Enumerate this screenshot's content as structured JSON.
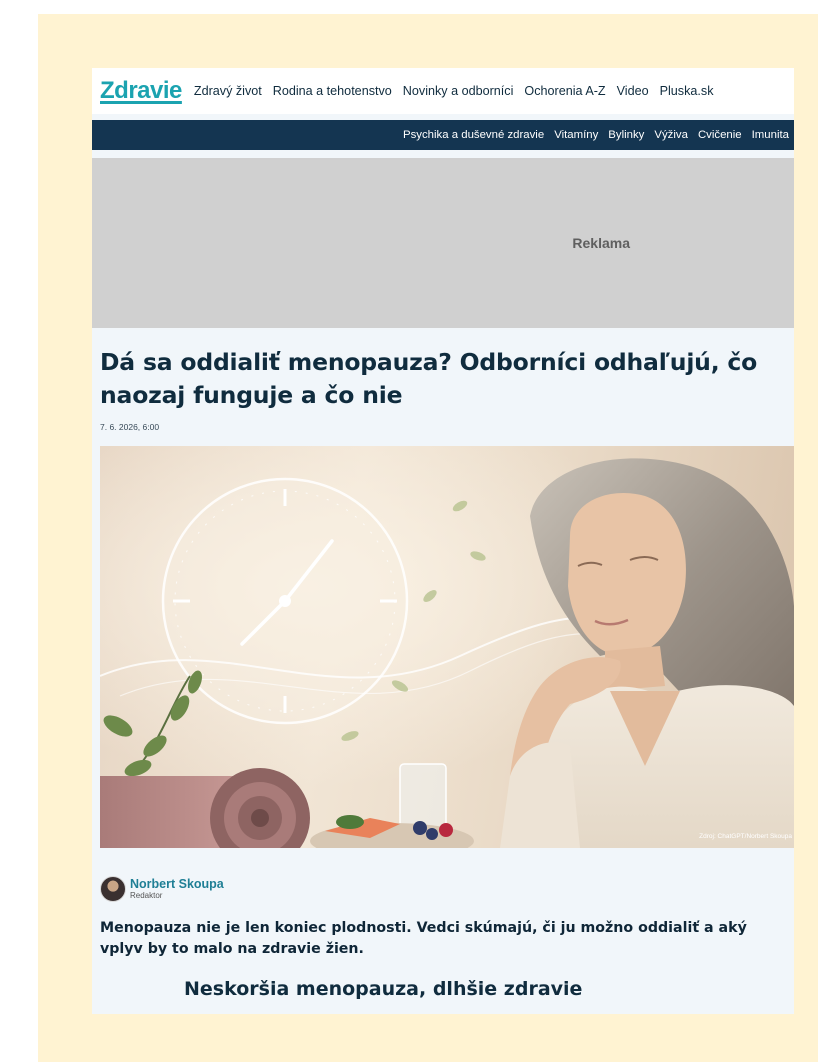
{
  "site": {
    "logo": "Zdravie",
    "top_links": [
      "Zdravý život",
      "Rodina a tehotenstvo",
      "Novinky a odborníci",
      "Ochorenia A-Z",
      "Video",
      "Pluska.sk"
    ],
    "sub_links": [
      "Psychika a duševné zdravie",
      "Vitamíny",
      "Bylinky",
      "Výživa",
      "Cvičenie",
      "Imunita"
    ]
  },
  "ad": {
    "label": "Reklama"
  },
  "article": {
    "title": "Dá sa oddialiť menopauza? Odborníci odhaľujú, čo naozaj funguje a čo nie",
    "date": "7. 6. 2026, 6:00",
    "image_credit": "Zdroj: ChatGPT/Norbert Skoupa",
    "image_icon": "illustration-woman-clock",
    "author": {
      "name": "Norbert Skoupa",
      "role": "Redaktor"
    },
    "lead": "Menopauza nie je len koniec plodnosti. Vedci skúmajú, či ju možno oddialiť a aký vplyv by to malo na zdravie žien.",
    "subheading": "Neskoršia menopauza, dlhšie zdravie"
  },
  "colors": {
    "frame": "#fff3d2",
    "page": "#f1f6fa",
    "brand": "#1ba3b0",
    "subnav": "#143551",
    "heading": "#102c3e",
    "author_link": "#1f7f95"
  }
}
